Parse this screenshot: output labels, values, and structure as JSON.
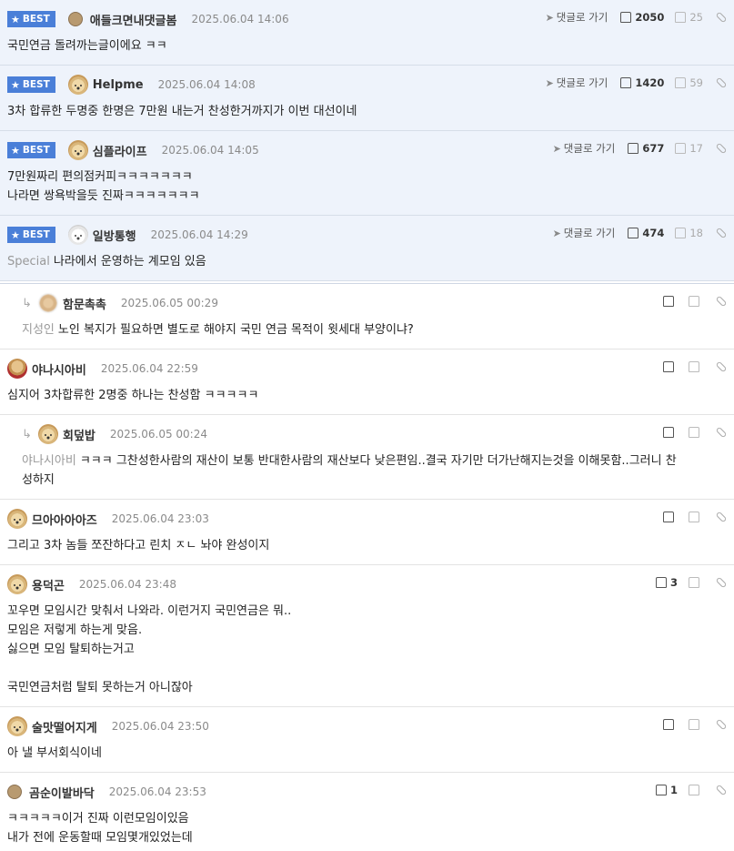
{
  "comments": [
    {
      "best": true,
      "badge": "BEST",
      "avatar": "dot",
      "nick": "애들크면내댓글봄",
      "date": "2025.06.04 14:06",
      "goto": "댓글로 가기",
      "up": "2050",
      "down": "25",
      "mention": "",
      "lines": [
        "국민연금 돌려까는글이에요 ㅋㅋ"
      ]
    },
    {
      "best": true,
      "badge": "BEST",
      "avatar": "puppy",
      "nick": "Helpme",
      "date": "2025.06.04 14:08",
      "goto": "댓글로 가기",
      "up": "1420",
      "down": "59",
      "mention": "",
      "lines": [
        "3차 합류한 두명중 한명은 7만원 내는거 찬성한거까지가 이번 대선이네"
      ]
    },
    {
      "best": true,
      "badge": "BEST",
      "avatar": "puppy",
      "nick": "심플라이프",
      "date": "2025.06.04 14:05",
      "goto": "댓글로 가기",
      "up": "677",
      "down": "17",
      "mention": "",
      "lines": [
        "7만원짜리 편의점커피ㅋㅋㅋㅋㅋㅋㅋ",
        "나라면 쌍욕박을듯 진짜ㅋㅋㅋㅋㅋㅋㅋ"
      ]
    },
    {
      "best": true,
      "badge": "BEST",
      "avatar": "white",
      "nick": "일방통행",
      "date": "2025.06.04 14:29",
      "goto": "댓글로 가기",
      "up": "474",
      "down": "18",
      "mention": "Special",
      "lines": [
        "나라에서 운영하는 계모임 있음"
      ]
    },
    {
      "best": false,
      "reply": true,
      "avatar": "blur",
      "nick": "함문촉촉",
      "date": "2025.06.05 00:29",
      "up": "",
      "mention": "지성인",
      "lines": [
        "노인 복지가 필요하면 별도로 해야지 국민 연금 목적이 윗세대 부양이냐?"
      ]
    },
    {
      "best": false,
      "reply": false,
      "avatar": "red",
      "nick": "야나시아비",
      "date": "2025.06.04 22:59",
      "up": "",
      "mention": "",
      "lines": [
        "심지어 3차합류한 2명중 하나는 찬성함 ㅋㅋㅋㅋㅋ"
      ]
    },
    {
      "best": false,
      "reply": true,
      "avatar": "puppy",
      "nick": "회덮밥",
      "date": "2025.06.05 00:24",
      "up": "",
      "mention": "야나시아비",
      "lines": [
        "ㅋㅋㅋ 그찬성한사람의 재산이 보통 반대한사람의 재산보다 낮은편임..결국 자기만 더가난해지는것을 이해못함..그러니 찬",
        "성하지"
      ]
    },
    {
      "best": false,
      "reply": false,
      "avatar": "puppy",
      "nick": "므아아아아즈",
      "date": "2025.06.04 23:03",
      "up": "",
      "mention": "",
      "lines": [
        "그리고 3차 놈들 쪼잔하다고 린치 ㅈㄴ 놔야 완성이지"
      ]
    },
    {
      "best": false,
      "reply": false,
      "avatar": "puppy",
      "nick": "용덕곤",
      "date": "2025.06.04 23:48",
      "up": "3",
      "mention": "",
      "lines": [
        "꼬우면 모임시간 맞춰서 나와라. 이런거지 국민연금은 뭐..",
        "모임은 저렇게 하는게 맞음.",
        "싫으면 모임 탈퇴하는거고",
        "",
        "국민연금처럼 탈퇴 못하는거 아니잖아"
      ]
    },
    {
      "best": false,
      "reply": false,
      "avatar": "puppy",
      "nick": "술맛떨어지게",
      "date": "2025.06.04 23:50",
      "up": "",
      "mention": "",
      "lines": [
        "아 낼 부서회식이네"
      ]
    },
    {
      "best": false,
      "reply": false,
      "avatar": "dot",
      "nick": "곰순이발바닥",
      "date": "2025.06.04 23:53",
      "up": "1",
      "mention": "",
      "lines": [
        "ㅋㅋㅋㅋㅋ이거 진짜 이런모임이있음",
        "내가 전에 운동할때 모임몇개있었는데"
      ]
    }
  ],
  "icons": {
    "reply": "reply-arrow-icon",
    "goto": "send-arrow-icon",
    "up": "thumbs-up-icon",
    "down": "thumbs-down-icon",
    "link": "link-icon"
  },
  "colors": {
    "best_badge": "#4a7fd8",
    "best_bg": "#eef3fb"
  }
}
